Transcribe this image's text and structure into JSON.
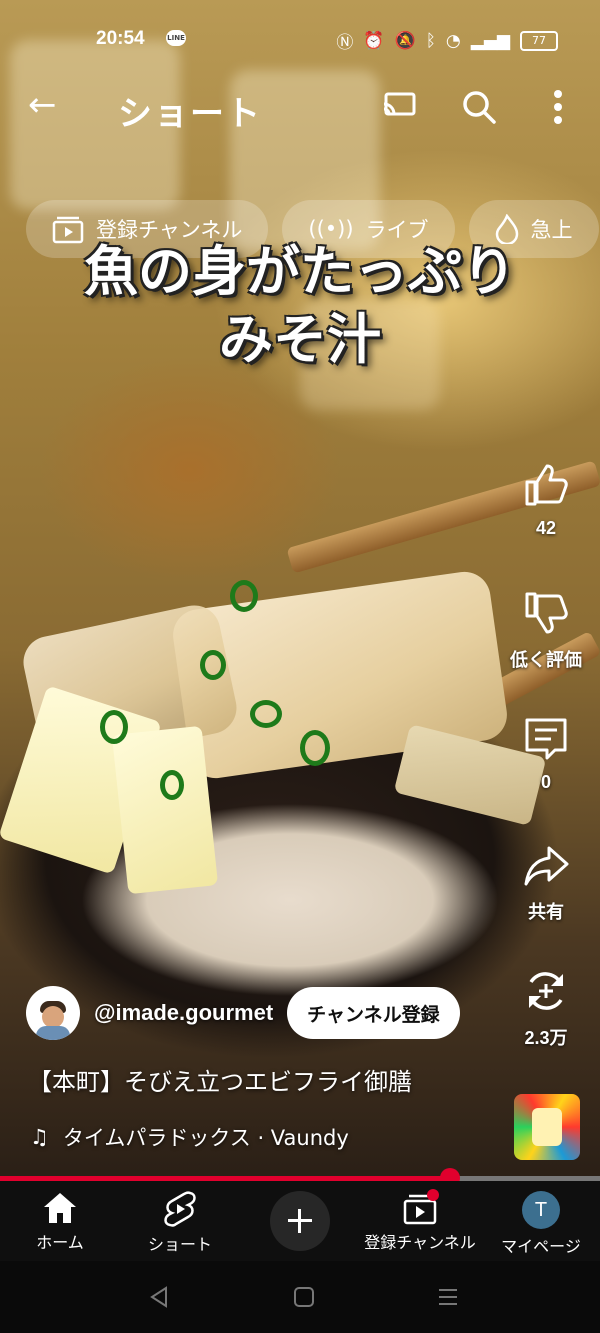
{
  "status_bar": {
    "time": "20:54",
    "battery": "77"
  },
  "header": {
    "title": "ショート"
  },
  "chips": [
    {
      "label": "登録チャンネル",
      "icon": "subscriptions-icon"
    },
    {
      "label": "ライブ",
      "icon": "live-icon"
    },
    {
      "label": "急上",
      "icon": "trending-icon"
    }
  ],
  "video": {
    "caption_line1": "魚の身がたっぷり",
    "caption_line2": "みそ汁",
    "channel_handle": "@imade.gourmet",
    "subscribe_label": "チャンネル登録",
    "title": "【本町】そびえ立つエビフライ御膳",
    "music": "タイムパラドックス · Vaundy",
    "progress": 0.75
  },
  "actions": {
    "like_count": "42",
    "dislike_label": "低く評価",
    "comment_count": "0",
    "share_label": "共有",
    "remix_count": "2.3万"
  },
  "nav": {
    "home": "ホーム",
    "shorts": "ショート",
    "subscriptions": "登録チャンネル",
    "you": "マイページ",
    "avatar_letter": "T"
  }
}
